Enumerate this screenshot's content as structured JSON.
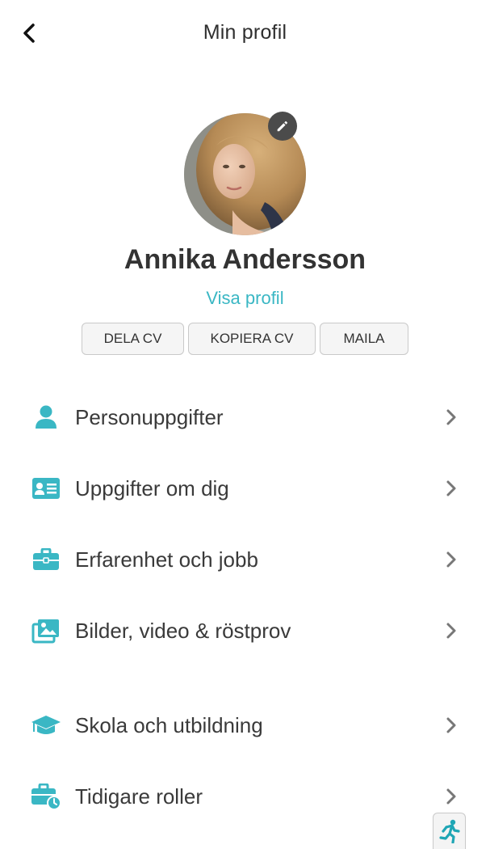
{
  "header": {
    "title": "Min profil"
  },
  "profile": {
    "name": "Annika Andersson",
    "view_link": "Visa profil"
  },
  "actions": [
    "DELA CV",
    "KOPIERA CV",
    "MAILA"
  ],
  "menu": [
    {
      "label": "Personuppgifter",
      "icon": "person-icon"
    },
    {
      "label": "Uppgifter om dig",
      "icon": "id-card-icon"
    },
    {
      "label": "Erfarenhet och jobb",
      "icon": "briefcase-icon"
    },
    {
      "label": "Bilder, video & röstprov",
      "icon": "images-icon"
    },
    {
      "label": "Skola och utbildning",
      "icon": "graduation-cap-icon"
    },
    {
      "label": "Tidigare roller",
      "icon": "briefcase-clock-icon"
    }
  ],
  "colors": {
    "accent": "#3ab7c4",
    "text": "#333333",
    "chevron": "#777777"
  }
}
